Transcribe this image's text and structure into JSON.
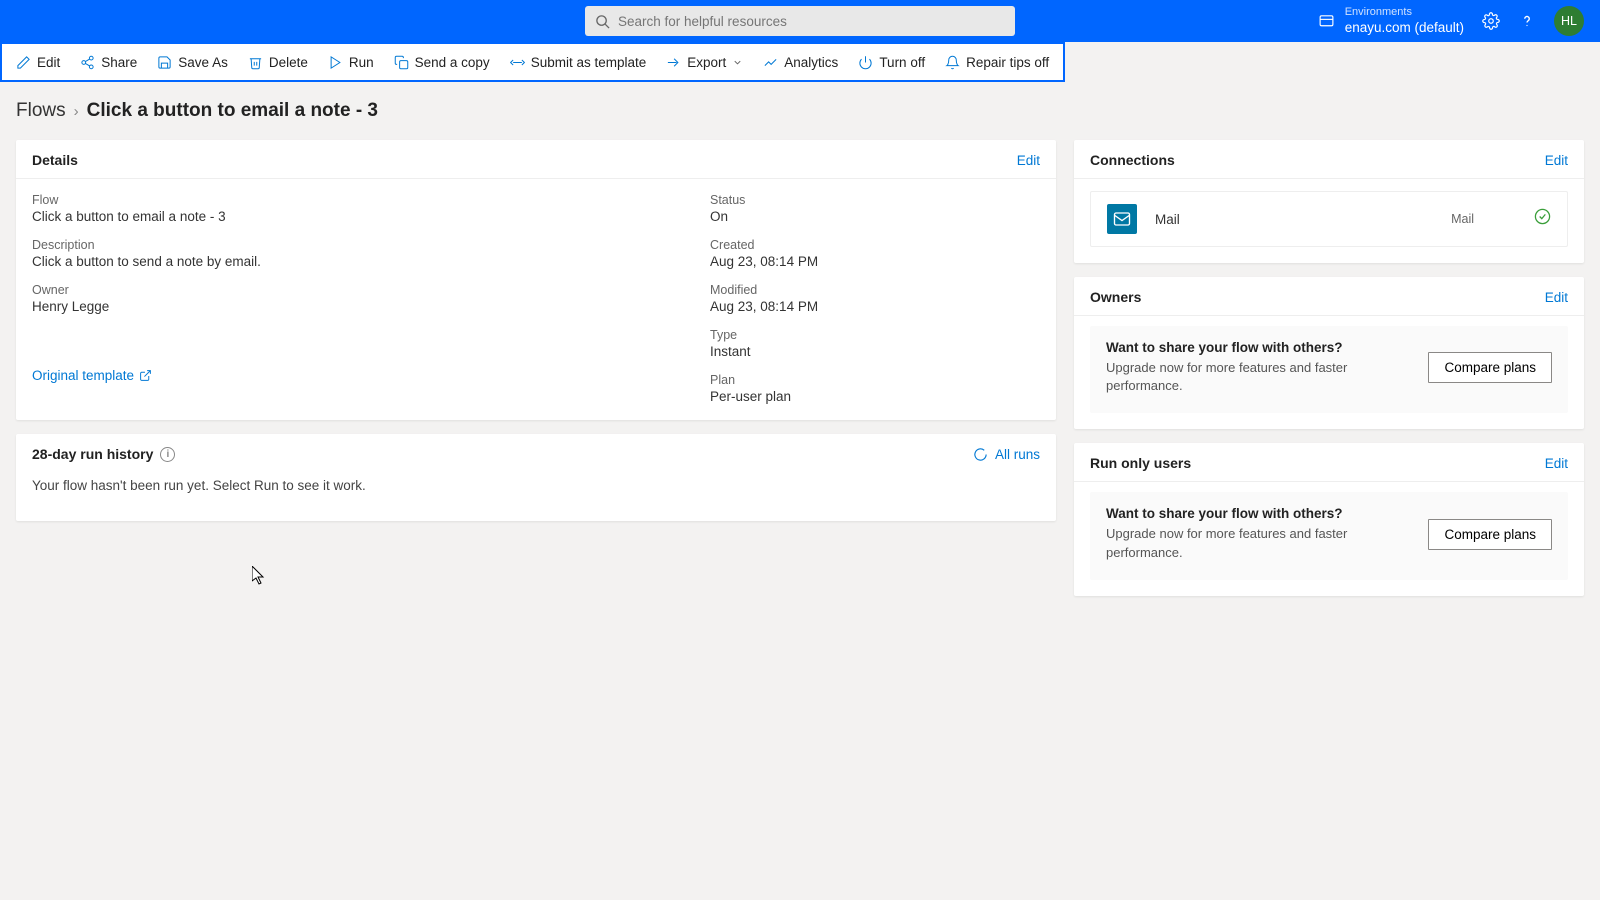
{
  "header": {
    "search_placeholder": "Search for helpful resources",
    "env_label": "Environments",
    "env_name": "enayu.com (default)",
    "avatar_initials": "HL"
  },
  "toolbar": {
    "edit": "Edit",
    "share": "Share",
    "save_as": "Save As",
    "delete": "Delete",
    "run": "Run",
    "send_copy": "Send a copy",
    "submit_tmpl": "Submit as template",
    "export": "Export",
    "analytics": "Analytics",
    "turn_off": "Turn off",
    "repair_tips": "Repair tips off"
  },
  "breadcrumb": {
    "root": "Flows",
    "current": "Click a button to email a note - 3"
  },
  "details": {
    "title": "Details",
    "edit": "Edit",
    "flow_lbl": "Flow",
    "flow_val": "Click a button to email a note - 3",
    "desc_lbl": "Description",
    "desc_val": "Click a button to send a note by email.",
    "owner_lbl": "Owner",
    "owner_val": "Henry Legge",
    "status_lbl": "Status",
    "status_val": "On",
    "created_lbl": "Created",
    "created_val": "Aug 23, 08:14 PM",
    "modified_lbl": "Modified",
    "modified_val": "Aug 23, 08:14 PM",
    "type_lbl": "Type",
    "type_val": "Instant",
    "plan_lbl": "Plan",
    "plan_val": "Per-user plan",
    "orig_tmpl": "Original template"
  },
  "history": {
    "title": "28-day run history",
    "all_runs": "All runs",
    "empty": "Your flow hasn't been run yet. Select Run to see it work."
  },
  "connections": {
    "title": "Connections",
    "edit": "Edit",
    "item_name": "Mail",
    "item_type": "Mail"
  },
  "owners": {
    "title": "Owners",
    "edit": "Edit",
    "promo_h": "Want to share your flow with others?",
    "promo_s": "Upgrade now for more features and faster performance.",
    "promo_btn": "Compare plans"
  },
  "run_only": {
    "title": "Run only users",
    "edit": "Edit",
    "promo_h": "Want to share your flow with others?",
    "promo_s": "Upgrade now for more features and faster performance.",
    "promo_btn": "Compare plans"
  }
}
